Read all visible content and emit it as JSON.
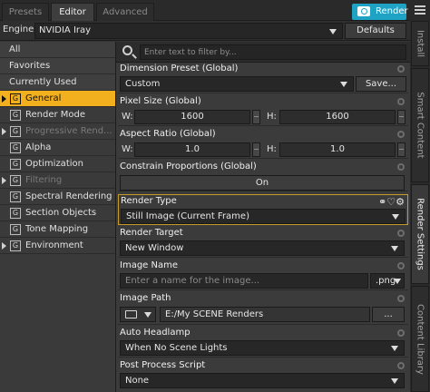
{
  "top_tabs": [
    {
      "label": "Presets",
      "active": false
    },
    {
      "label": "Editor",
      "active": true
    },
    {
      "label": "Advanced",
      "active": false
    }
  ],
  "render_button": {
    "label": "Render",
    "color": "#1fa3c4"
  },
  "menu_icon": "hamburger-menu-icon",
  "engine": {
    "label": "Engine :",
    "value": "NVIDIA Iray",
    "defaults_label": "Defaults"
  },
  "side_tabs": [
    {
      "label": "Install",
      "active": false
    },
    {
      "label": "Smart Content",
      "active": false
    },
    {
      "label": "Render Settings",
      "active": true
    },
    {
      "label": "Content Library",
      "active": false
    }
  ],
  "left_list": {
    "top_items": [
      "All",
      "Favorites",
      "Currently Used"
    ],
    "groups": [
      {
        "label": "General",
        "expandable": true,
        "selected": true,
        "enabled": true
      },
      {
        "label": "Render Mode",
        "expandable": false,
        "selected": false,
        "enabled": true
      },
      {
        "label": "Progressive Rend...",
        "expandable": true,
        "selected": false,
        "enabled": false
      },
      {
        "label": "Alpha",
        "expandable": false,
        "selected": false,
        "enabled": true
      },
      {
        "label": "Optimization",
        "expandable": false,
        "selected": false,
        "enabled": true
      },
      {
        "label": "Filtering",
        "expandable": true,
        "selected": false,
        "enabled": false
      },
      {
        "label": "Spectral Rendering",
        "expandable": false,
        "selected": false,
        "enabled": true
      },
      {
        "label": "Section Objects",
        "expandable": false,
        "selected": false,
        "enabled": true
      },
      {
        "label": "Tone Mapping",
        "expandable": false,
        "selected": false,
        "enabled": true
      },
      {
        "label": "Environment",
        "expandable": true,
        "selected": false,
        "enabled": true
      }
    ],
    "group_icon_letter": "G",
    "selected_color": "#f2b01e"
  },
  "search": {
    "placeholder": "Enter text to filter by..."
  },
  "properties": {
    "dimension_preset": {
      "title": "Dimension Preset (Global)",
      "value": "Custom",
      "save_label": "Save..."
    },
    "pixel_size": {
      "title": "Pixel Size (Global)",
      "w_label": "W:",
      "w_value": "1600",
      "h_label": "H:",
      "h_value": "1600"
    },
    "aspect_ratio": {
      "title": "Aspect Ratio (Global)",
      "w_label": "W:",
      "w_value": "1.0",
      "h_label": "H:",
      "h_value": "1.0"
    },
    "constrain": {
      "title": "Constrain Proportions (Global)",
      "value": "On"
    },
    "render_type": {
      "title": "Render Type",
      "value": "Still Image (Current Frame)"
    },
    "render_target": {
      "title": "Render Target",
      "value": "New Window"
    },
    "image_name": {
      "title": "Image Name",
      "placeholder": "Enter a name for the image...",
      "extension": ".png"
    },
    "image_path": {
      "title": "Image Path",
      "value": "E:/My SCENE Renders",
      "browse_label": "..."
    },
    "auto_headlamp": {
      "title": "Auto Headlamp",
      "value": "When No Scene Lights"
    },
    "post_process": {
      "title": "Post Process Script",
      "value": "None"
    }
  }
}
